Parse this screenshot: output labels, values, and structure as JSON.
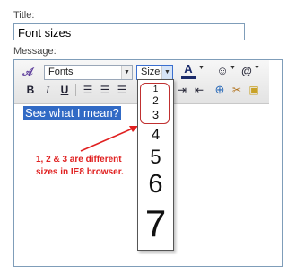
{
  "form": {
    "title_label": "Title:",
    "title_value": "Font sizes",
    "message_label": "Message:"
  },
  "toolbar": {
    "fonts_label": "Fonts",
    "sizes_label": "Sizes",
    "bold_label": "B",
    "italic_label": "I",
    "underline_label": "U"
  },
  "editor": {
    "selected_text": "See what I mean?"
  },
  "sizes_dropdown": {
    "options": [
      "1",
      "2",
      "3",
      "4",
      "5",
      "6",
      "7"
    ]
  },
  "annotation": {
    "text": "1, 2 & 3 are different sizes in IE8 browser."
  },
  "colors": {
    "selection": "#316ac5",
    "annotation": "#e02020",
    "highlight_box": "#c03030"
  }
}
